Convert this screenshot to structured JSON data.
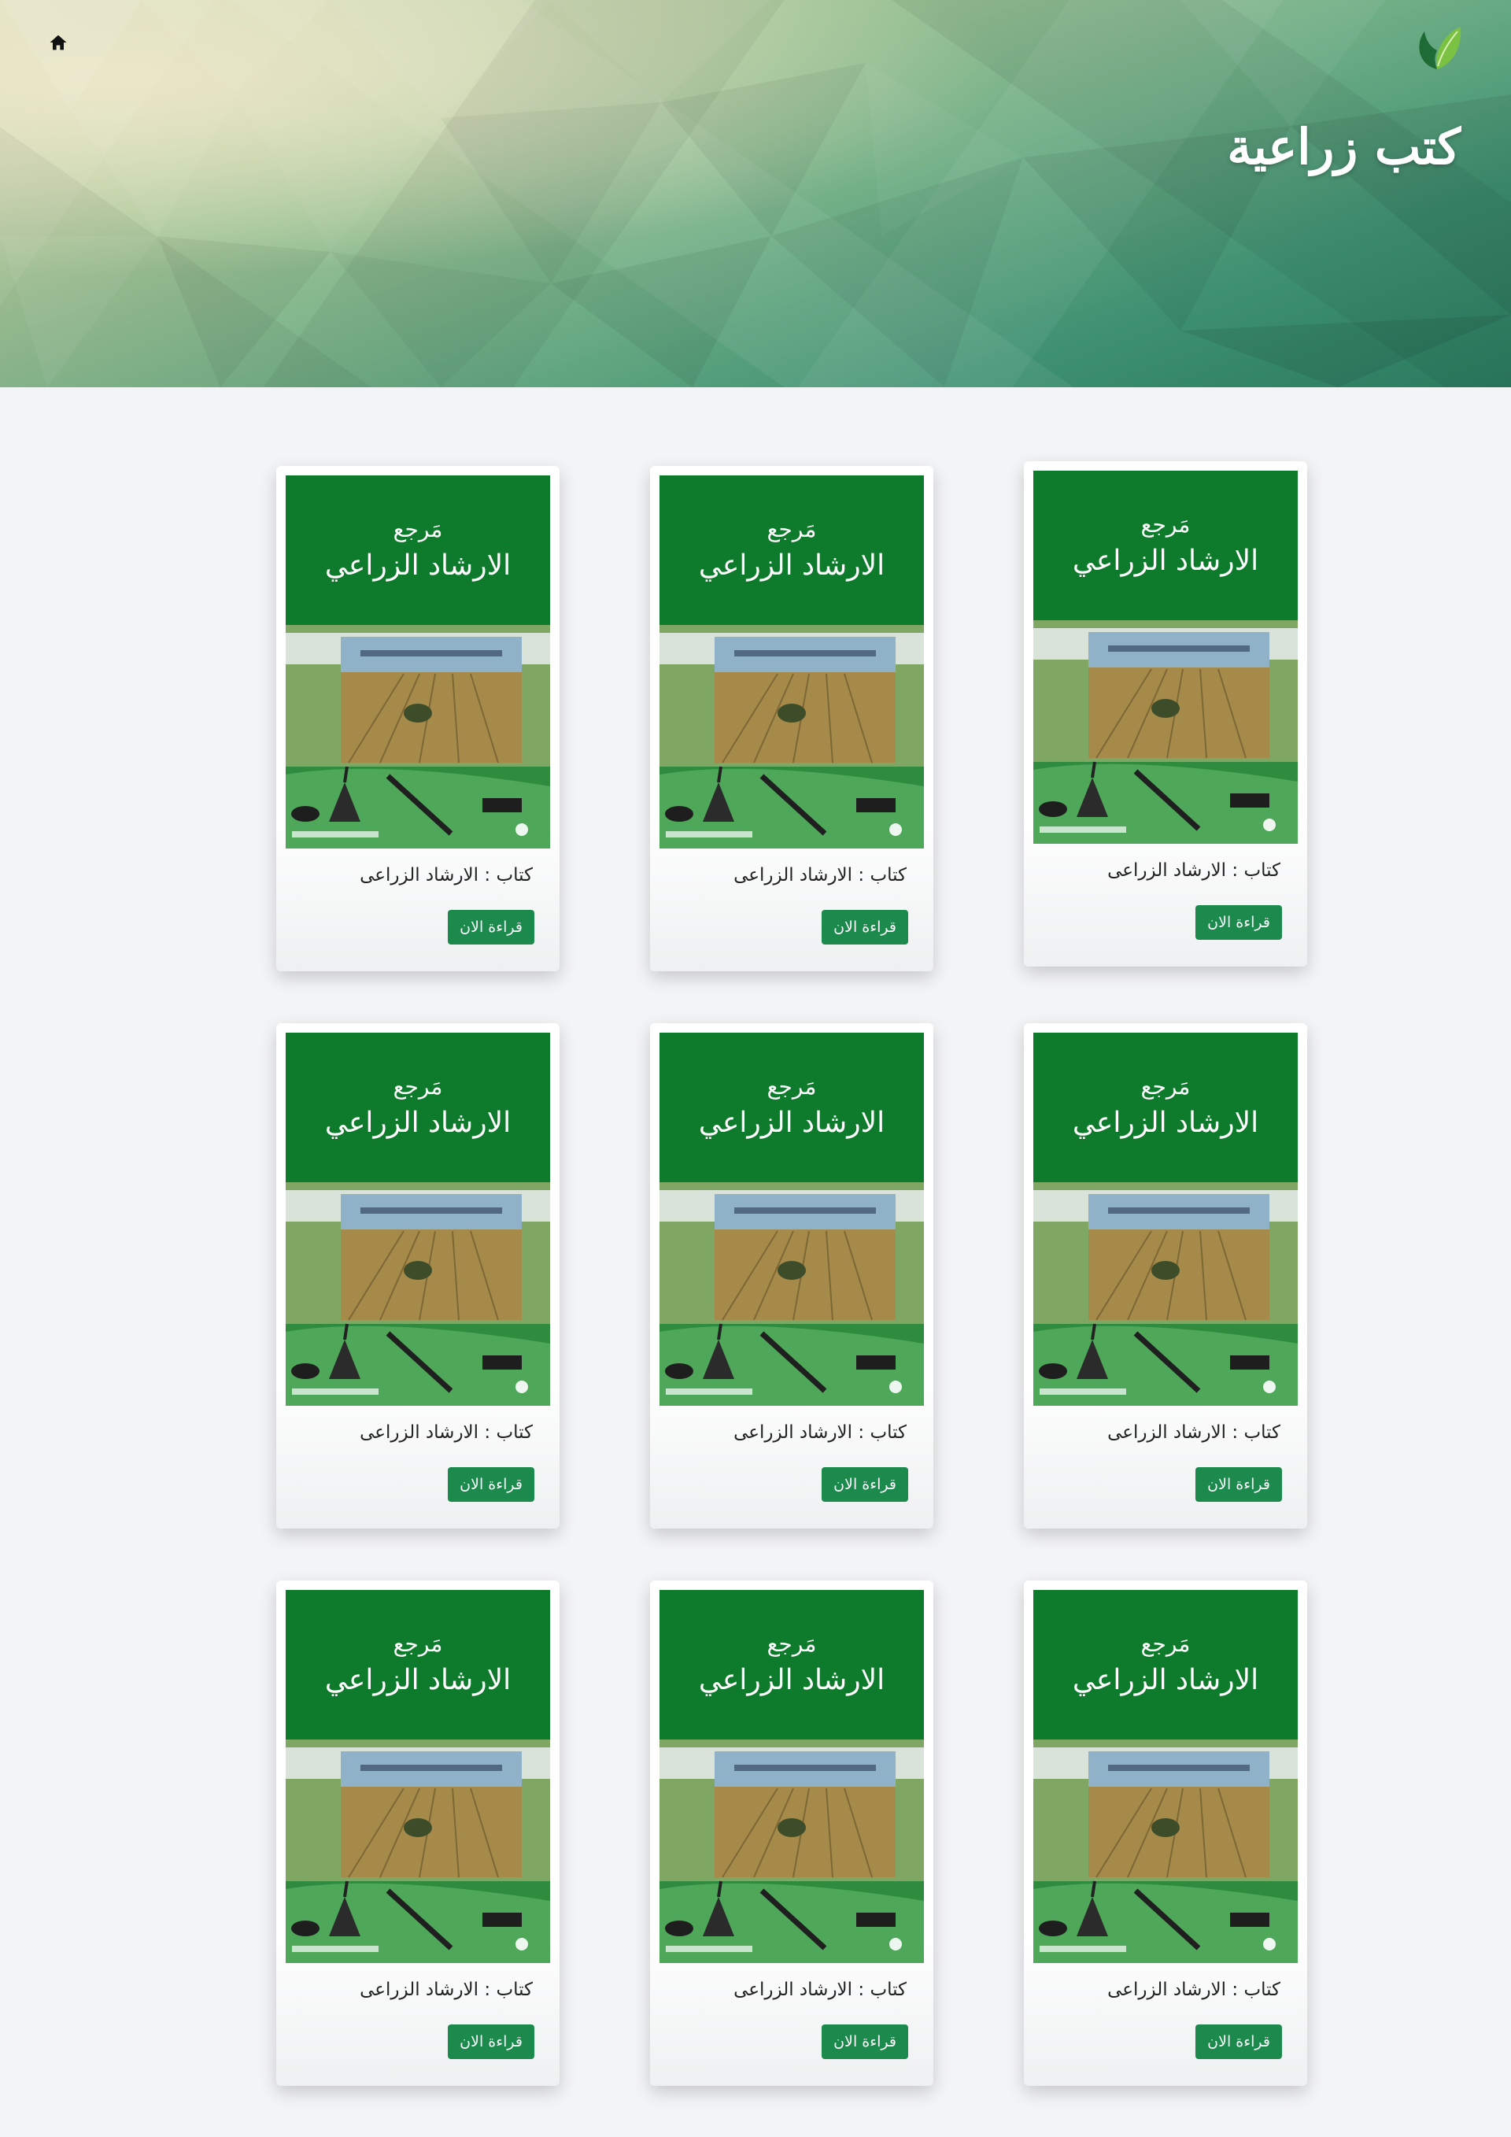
{
  "header": {
    "title": "كتب زراعية",
    "home_icon": "home-icon",
    "logo_icon": "leaf-icon"
  },
  "colors": {
    "accent": "#1b8a4c",
    "cover_green": "#0f7b2a"
  },
  "books": [
    {
      "caption": "كتاب : الارشاد الزراعى",
      "button": "قراءة الان",
      "cover_title_top": "مَرجع",
      "cover_title_main": "الارشاد الزراعي"
    },
    {
      "caption": "كتاب : الارشاد الزراعى",
      "button": "قراءة الان",
      "cover_title_top": "مَرجع",
      "cover_title_main": "الارشاد الزراعي"
    },
    {
      "caption": "كتاب : الارشاد الزراعى",
      "button": "قراءة الان",
      "cover_title_top": "مَرجع",
      "cover_title_main": "الارشاد الزراعي"
    },
    {
      "caption": "كتاب : الارشاد الزراعى",
      "button": "قراءة الان",
      "cover_title_top": "مَرجع",
      "cover_title_main": "الارشاد الزراعي"
    },
    {
      "caption": "كتاب : الارشاد الزراعى",
      "button": "قراءة الان",
      "cover_title_top": "مَرجع",
      "cover_title_main": "الارشاد الزراعي"
    },
    {
      "caption": "كتاب : الارشاد الزراعى",
      "button": "قراءة الان",
      "cover_title_top": "مَرجع",
      "cover_title_main": "الارشاد الزراعي"
    },
    {
      "caption": "كتاب : الارشاد الزراعى",
      "button": "قراءة الان",
      "cover_title_top": "مَرجع",
      "cover_title_main": "الارشاد الزراعي"
    },
    {
      "caption": "كتاب : الارشاد الزراعى",
      "button": "قراءة الان",
      "cover_title_top": "مَرجع",
      "cover_title_main": "الارشاد الزراعي"
    },
    {
      "caption": "كتاب : الارشاد الزراعى",
      "button": "قراءة الان",
      "cover_title_top": "مَرجع",
      "cover_title_main": "الارشاد الزراعي"
    }
  ]
}
